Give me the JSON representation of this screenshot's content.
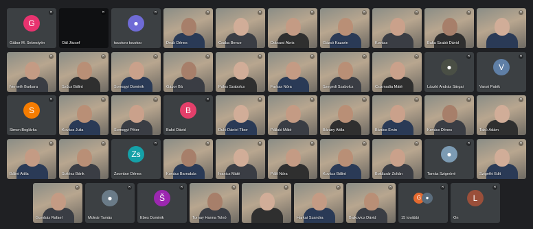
{
  "colors": {
    "tile": "#3c4043",
    "accent_g": "#e8336f",
    "accent_s_orange": "#f57c00",
    "accent_v": "#5f7fa6",
    "accent_b": "#e43f6a",
    "accent_zs": "#15a1a8",
    "accent_s_purple": "#9c27b0",
    "accent_l": "#9a4f3a"
  },
  "participants": [
    {
      "name": "Gábor M. Sebestyén",
      "kind": "avatar",
      "initial": "G",
      "color": "#e8336f",
      "row": 0,
      "col": 0
    },
    {
      "name": "Oál József",
      "kind": "dark",
      "row": 0,
      "col": 1
    },
    {
      "name": "tocotoro tocotoo",
      "kind": "avatar-photo",
      "initial": "●",
      "color": "#6f6bd6",
      "row": 0,
      "col": 2
    },
    {
      "name": "Deák Dénes",
      "kind": "video",
      "row": 0,
      "col": 3
    },
    {
      "name": "Csaba Bence",
      "kind": "video",
      "row": 0,
      "col": 4
    },
    {
      "name": "Dobozsi Ábris",
      "kind": "video",
      "row": 0,
      "col": 5
    },
    {
      "name": "Gózsó Kazarin",
      "kind": "video",
      "row": 0,
      "col": 6
    },
    {
      "name": "Kovács",
      "kind": "video",
      "row": 0,
      "col": 7
    },
    {
      "name": "Baka Szabó Dávid",
      "kind": "video",
      "row": 0,
      "col": 8
    },
    {
      "name": "",
      "kind": "video",
      "row": 0,
      "col": 9
    },
    {
      "name": "Nemeth Barbara",
      "kind": "video",
      "row": 1,
      "col": 0
    },
    {
      "name": "Szűcs Bálint",
      "kind": "video",
      "row": 1,
      "col": 1
    },
    {
      "name": "Somogyi Dominik",
      "kind": "video",
      "row": 1,
      "col": 2
    },
    {
      "name": "Gábor Bá",
      "kind": "video",
      "row": 1,
      "col": 3
    },
    {
      "name": "Pálos Szabolcs",
      "kind": "video",
      "row": 1,
      "col": 4
    },
    {
      "name": "Farkas Nóra",
      "kind": "video",
      "row": 1,
      "col": 5
    },
    {
      "name": "Szegedi Szabolcs",
      "kind": "video",
      "row": 1,
      "col": 6
    },
    {
      "name": "Csizmadia Máté",
      "kind": "video",
      "row": 1,
      "col": 7
    },
    {
      "name": "László András Sárgai",
      "kind": "avatar-photo",
      "initial": "●",
      "color": "#4a4f45",
      "row": 1,
      "col": 8
    },
    {
      "name": "Varsó Patrik",
      "kind": "avatar",
      "initial": "V",
      "color": "#5f7fa6",
      "row": 1,
      "col": 9
    },
    {
      "name": "Simon Boglárka",
      "kind": "avatar",
      "initial": "S",
      "color": "#f57c00",
      "row": 2,
      "col": 0
    },
    {
      "name": "Kovács Julia",
      "kind": "video",
      "row": 2,
      "col": 1
    },
    {
      "name": "Somogyi Péter",
      "kind": "video",
      "row": 2,
      "col": 2
    },
    {
      "name": "Bakó Dávid",
      "kind": "avatar",
      "initial": "B",
      "color": "#e43f6a",
      "row": 2,
      "col": 3
    },
    {
      "name": "Duló Dániel Tibor",
      "kind": "video",
      "row": 2,
      "col": 4
    },
    {
      "name": "Pállaki Máté",
      "kind": "video",
      "row": 2,
      "col": 5
    },
    {
      "name": "Bárány Attila",
      "kind": "video",
      "row": 2,
      "col": 6
    },
    {
      "name": "Bárdos Ervin",
      "kind": "video",
      "row": 2,
      "col": 7
    },
    {
      "name": "Kovács Dénes",
      "kind": "video",
      "row": 2,
      "col": 8
    },
    {
      "name": "Takó Ádám",
      "kind": "video",
      "row": 2,
      "col": 9
    },
    {
      "name": "Bálint Attila",
      "kind": "video",
      "row": 3,
      "col": 0
    },
    {
      "name": "Soltész Bánk",
      "kind": "video",
      "row": 3,
      "col": 1
    },
    {
      "name": "Zsombor Dénes",
      "kind": "avatar",
      "initial": "Zs",
      "color": "#15a1a8",
      "row": 3,
      "col": 2
    },
    {
      "name": "Kovács Barnabás",
      "kind": "video",
      "row": 3,
      "col": 3
    },
    {
      "name": "Ivanics Máté",
      "kind": "video",
      "row": 3,
      "col": 4
    },
    {
      "name": "Pálfi Nóra",
      "kind": "video",
      "row": 3,
      "col": 5
    },
    {
      "name": "Kovács Bálint",
      "kind": "video",
      "row": 3,
      "col": 6
    },
    {
      "name": "Boldizsár Zoltán",
      "kind": "video",
      "row": 3,
      "col": 7
    },
    {
      "name": "Tamás Szignóné",
      "kind": "avatar-photo",
      "initial": "●",
      "color": "#7c9bb3",
      "row": 3,
      "col": 8
    },
    {
      "name": "Szigethi Edit",
      "kind": "video",
      "row": 3,
      "col": 9
    },
    {
      "name": "Gombás Rafael",
      "kind": "video",
      "row": 4,
      "col": 0
    },
    {
      "name": "Molnár Tamás",
      "kind": "avatar-photo",
      "initial": "●",
      "color": "#6a7b88",
      "row": 4,
      "col": 1
    },
    {
      "name": "Ébes Dominik",
      "kind": "avatar",
      "initial": "Š",
      "color": "#9c27b0",
      "row": 4,
      "col": 2
    },
    {
      "name": "Tornay Hanna Tolnó",
      "kind": "video",
      "row": 4,
      "col": 3
    },
    {
      "name": "",
      "kind": "video",
      "row": 4,
      "col": 4
    },
    {
      "name": "Harkai Szandra",
      "kind": "video",
      "row": 4,
      "col": 5
    },
    {
      "name": "Bajkovics Dávid",
      "kind": "video",
      "row": 4,
      "col": 6
    },
    {
      "name": "15 további",
      "kind": "stack",
      "row": 4,
      "col": 7
    },
    {
      "name": "Ön",
      "kind": "avatar",
      "initial": "L",
      "color": "#9a4f3a",
      "row": 4,
      "col": 8
    }
  ]
}
